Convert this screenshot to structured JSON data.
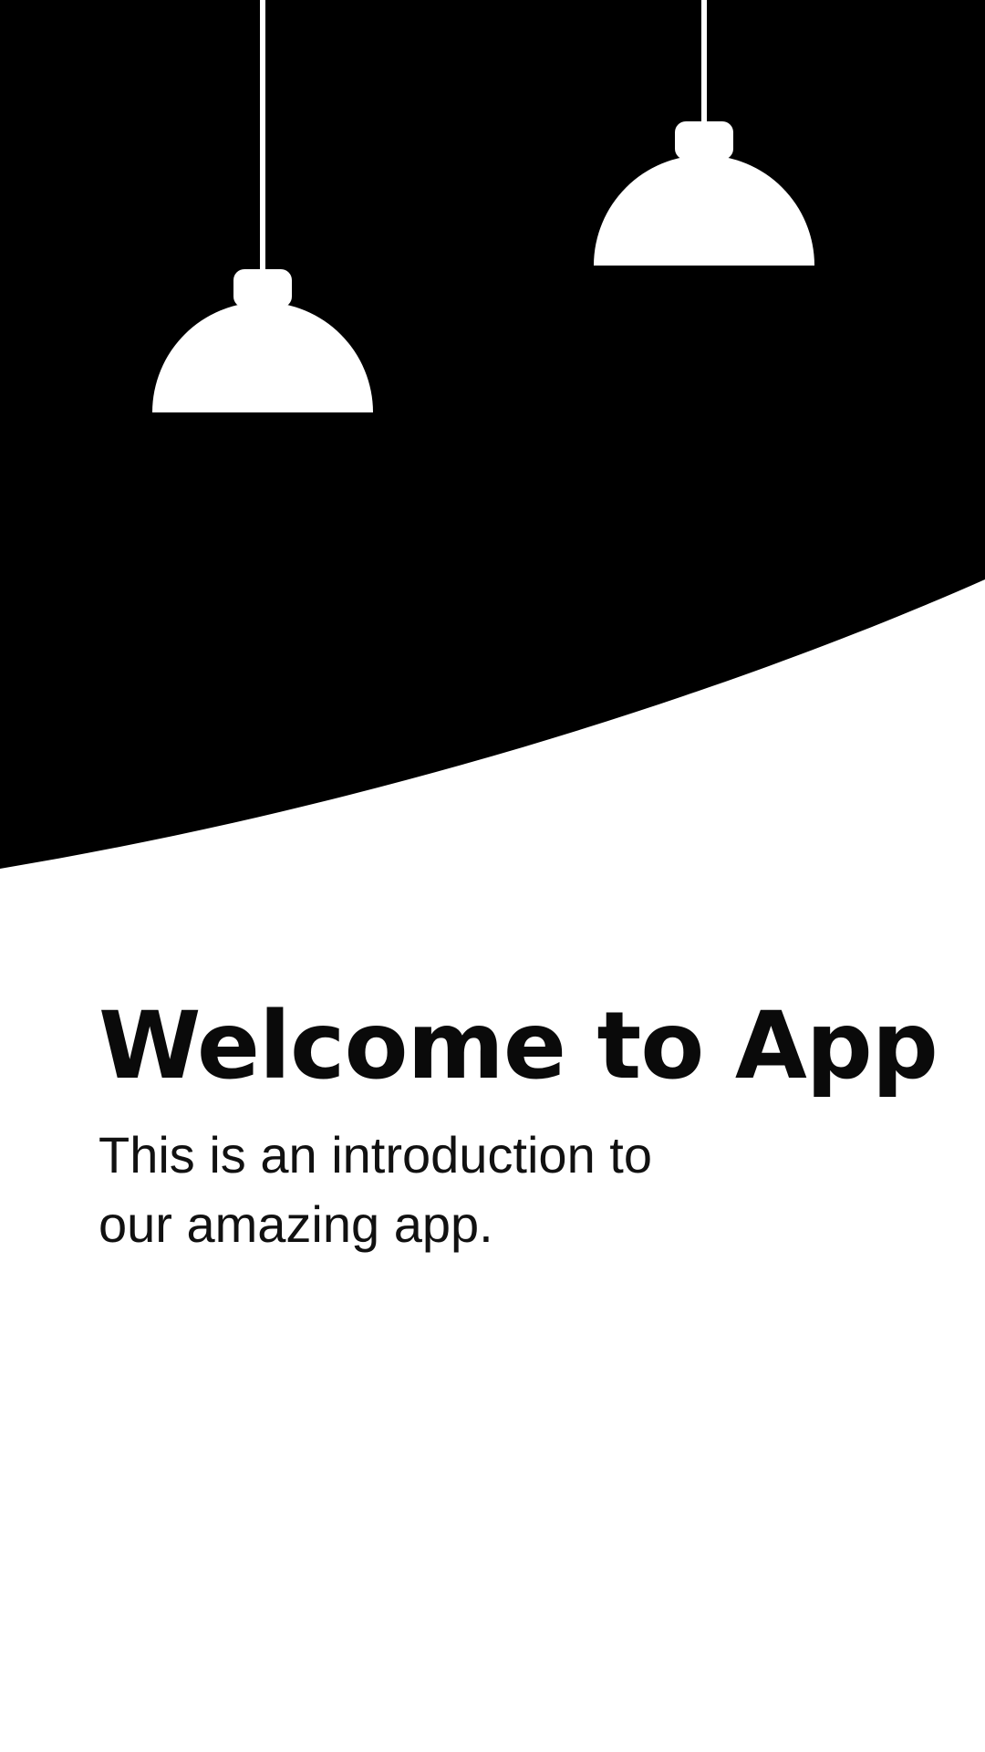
{
  "screen": {
    "title": "Welcome to App",
    "subtitle": "This is an introduction to our amazing app."
  },
  "illustration": {
    "icons": [
      "pendant-lamp-icon",
      "pendant-lamp-icon"
    ],
    "colors": {
      "background": "#ffffff",
      "hero_fill": "#000000",
      "lamp_fill": "#ffffff",
      "text": "#0a0a0a"
    }
  }
}
